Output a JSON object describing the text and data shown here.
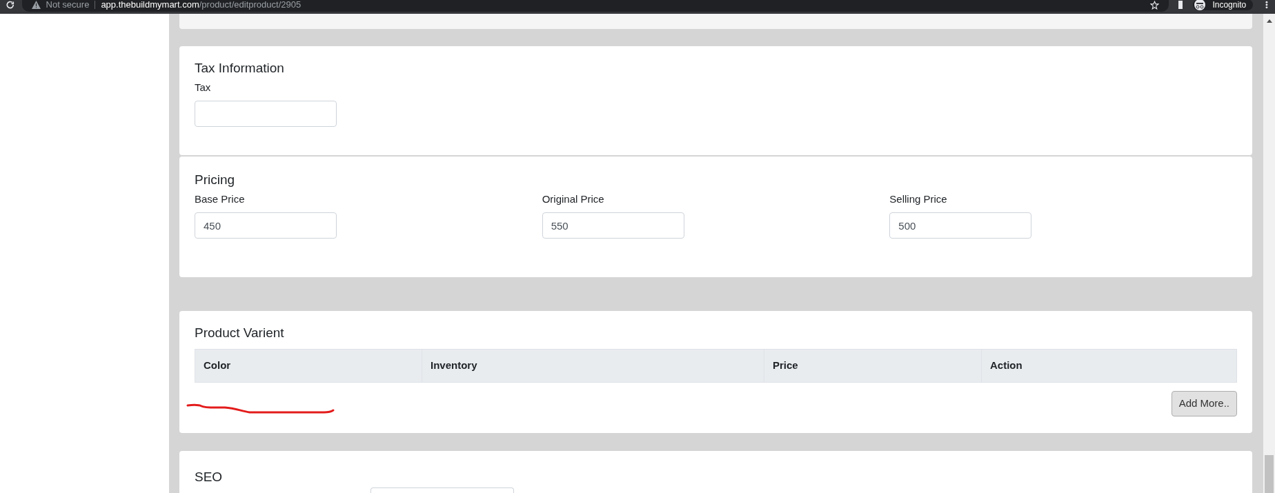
{
  "browser": {
    "security": "Not secure",
    "url_host": "app.thebuildmymart.com",
    "url_path": "/product/editproduct/2905",
    "profile": "Incognito"
  },
  "tax": {
    "title": "Tax Information",
    "label": "Tax"
  },
  "pricing": {
    "title": "Pricing",
    "fields": [
      {
        "label": "Base Price",
        "value": "450"
      },
      {
        "label": "Original Price",
        "value": "550"
      },
      {
        "label": "Selling Price",
        "value": "500"
      }
    ]
  },
  "variant": {
    "title": "Product Varient",
    "columns": [
      "Color",
      "Inventory",
      "Price",
      "Action"
    ],
    "button": "Add More.."
  },
  "seo": {
    "title": "SEO"
  }
}
